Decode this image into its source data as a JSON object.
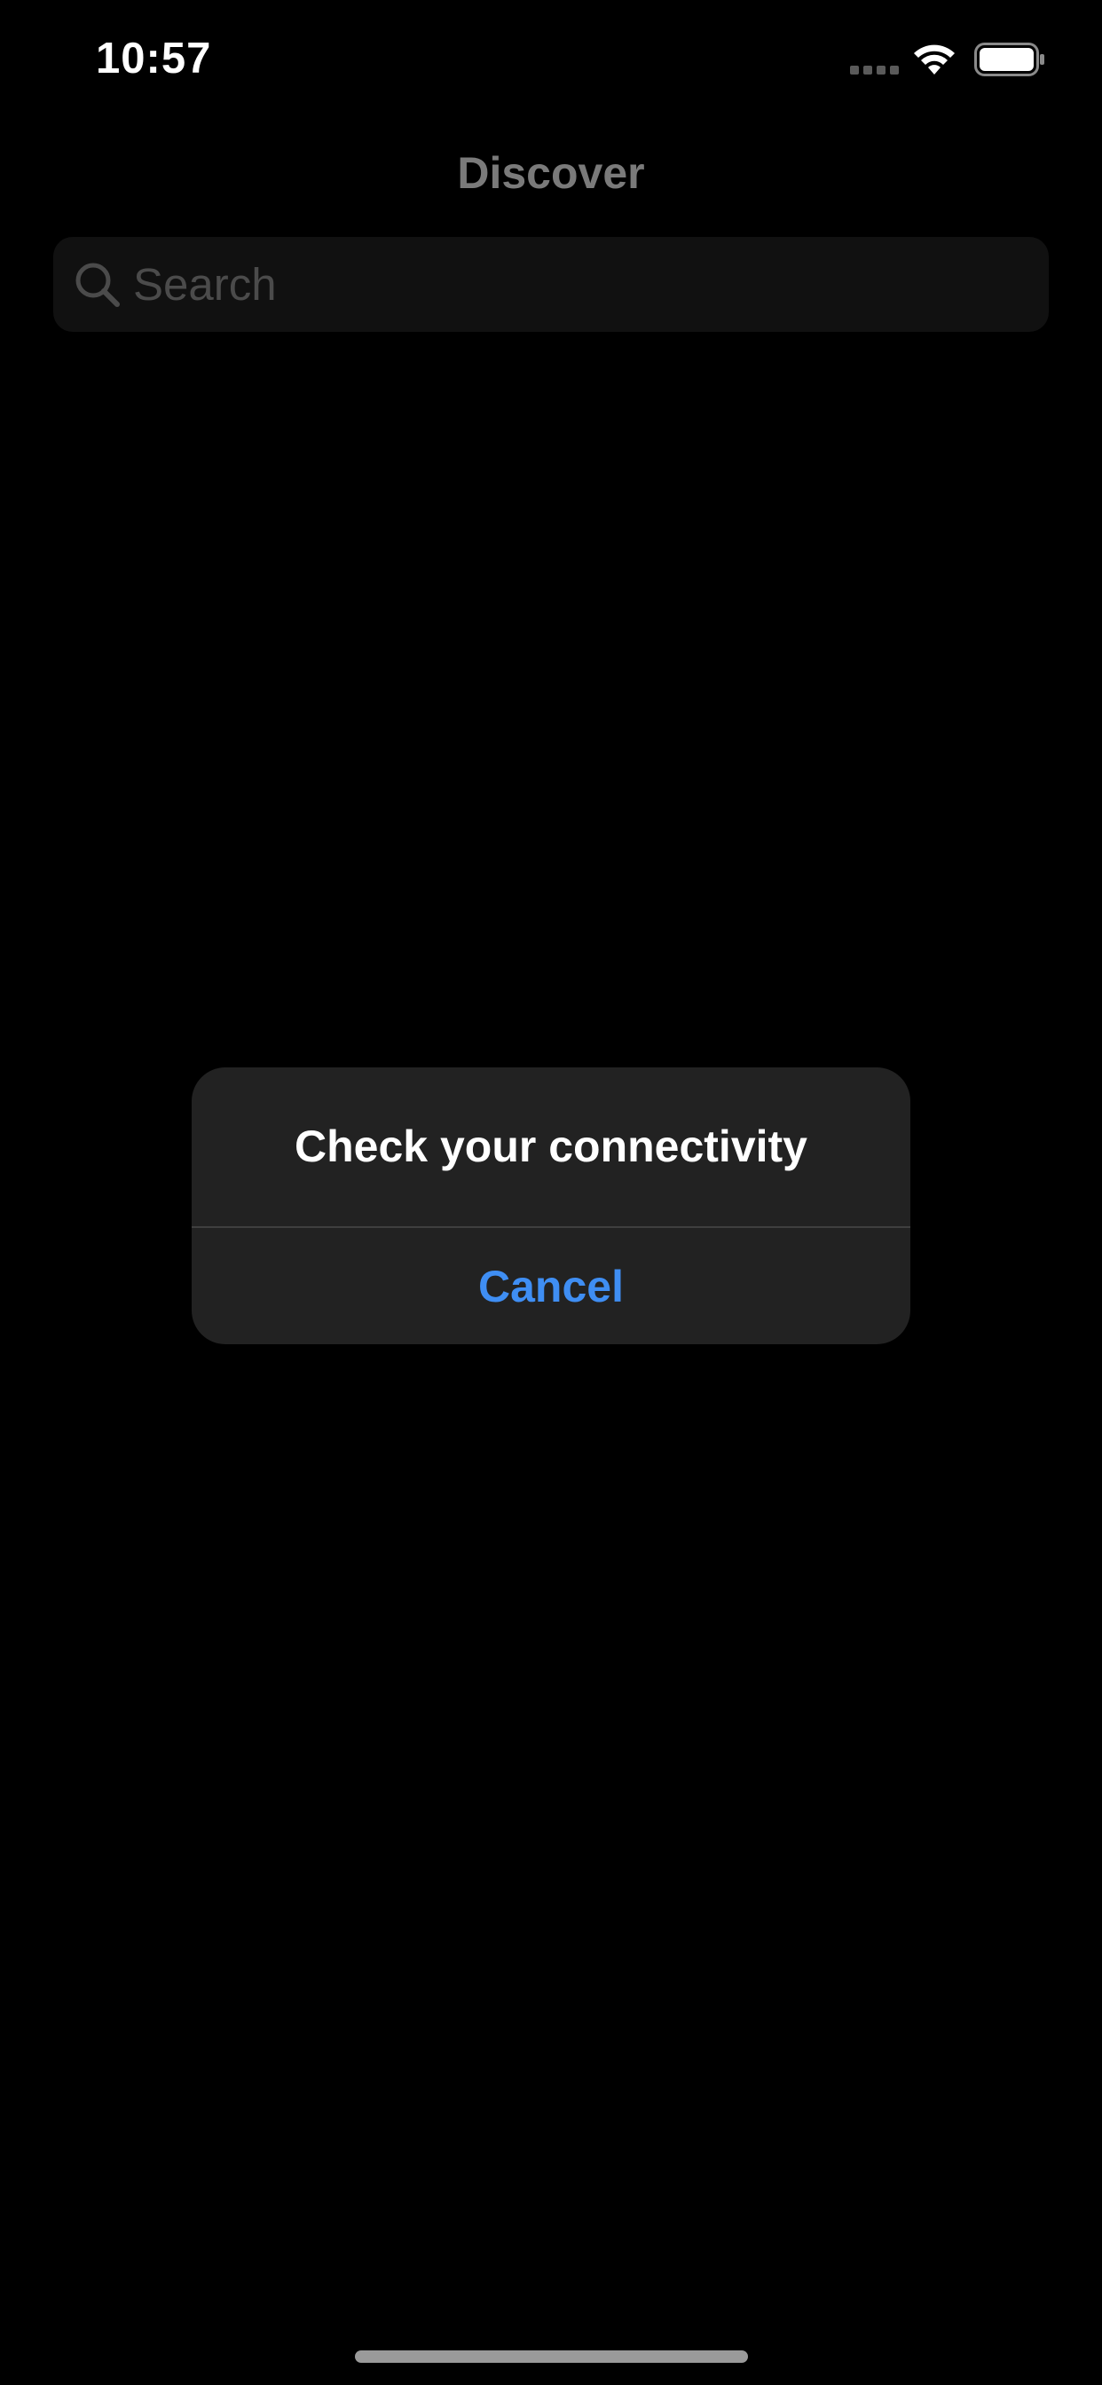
{
  "status_bar": {
    "time": "10:57",
    "icons": [
      "cellular-signal-icon",
      "wifi-icon",
      "battery-icon"
    ]
  },
  "nav": {
    "title": "Discover"
  },
  "search": {
    "placeholder": "Search",
    "value": "",
    "icon": "search-icon"
  },
  "alert": {
    "title": "Check your connectivity",
    "cancel_label": "Cancel"
  },
  "colors": {
    "background": "#000000",
    "alert_background": "#222222",
    "accent": "#3f8ef3",
    "title_text": "#7a7a7a",
    "search_background": "#111111"
  }
}
